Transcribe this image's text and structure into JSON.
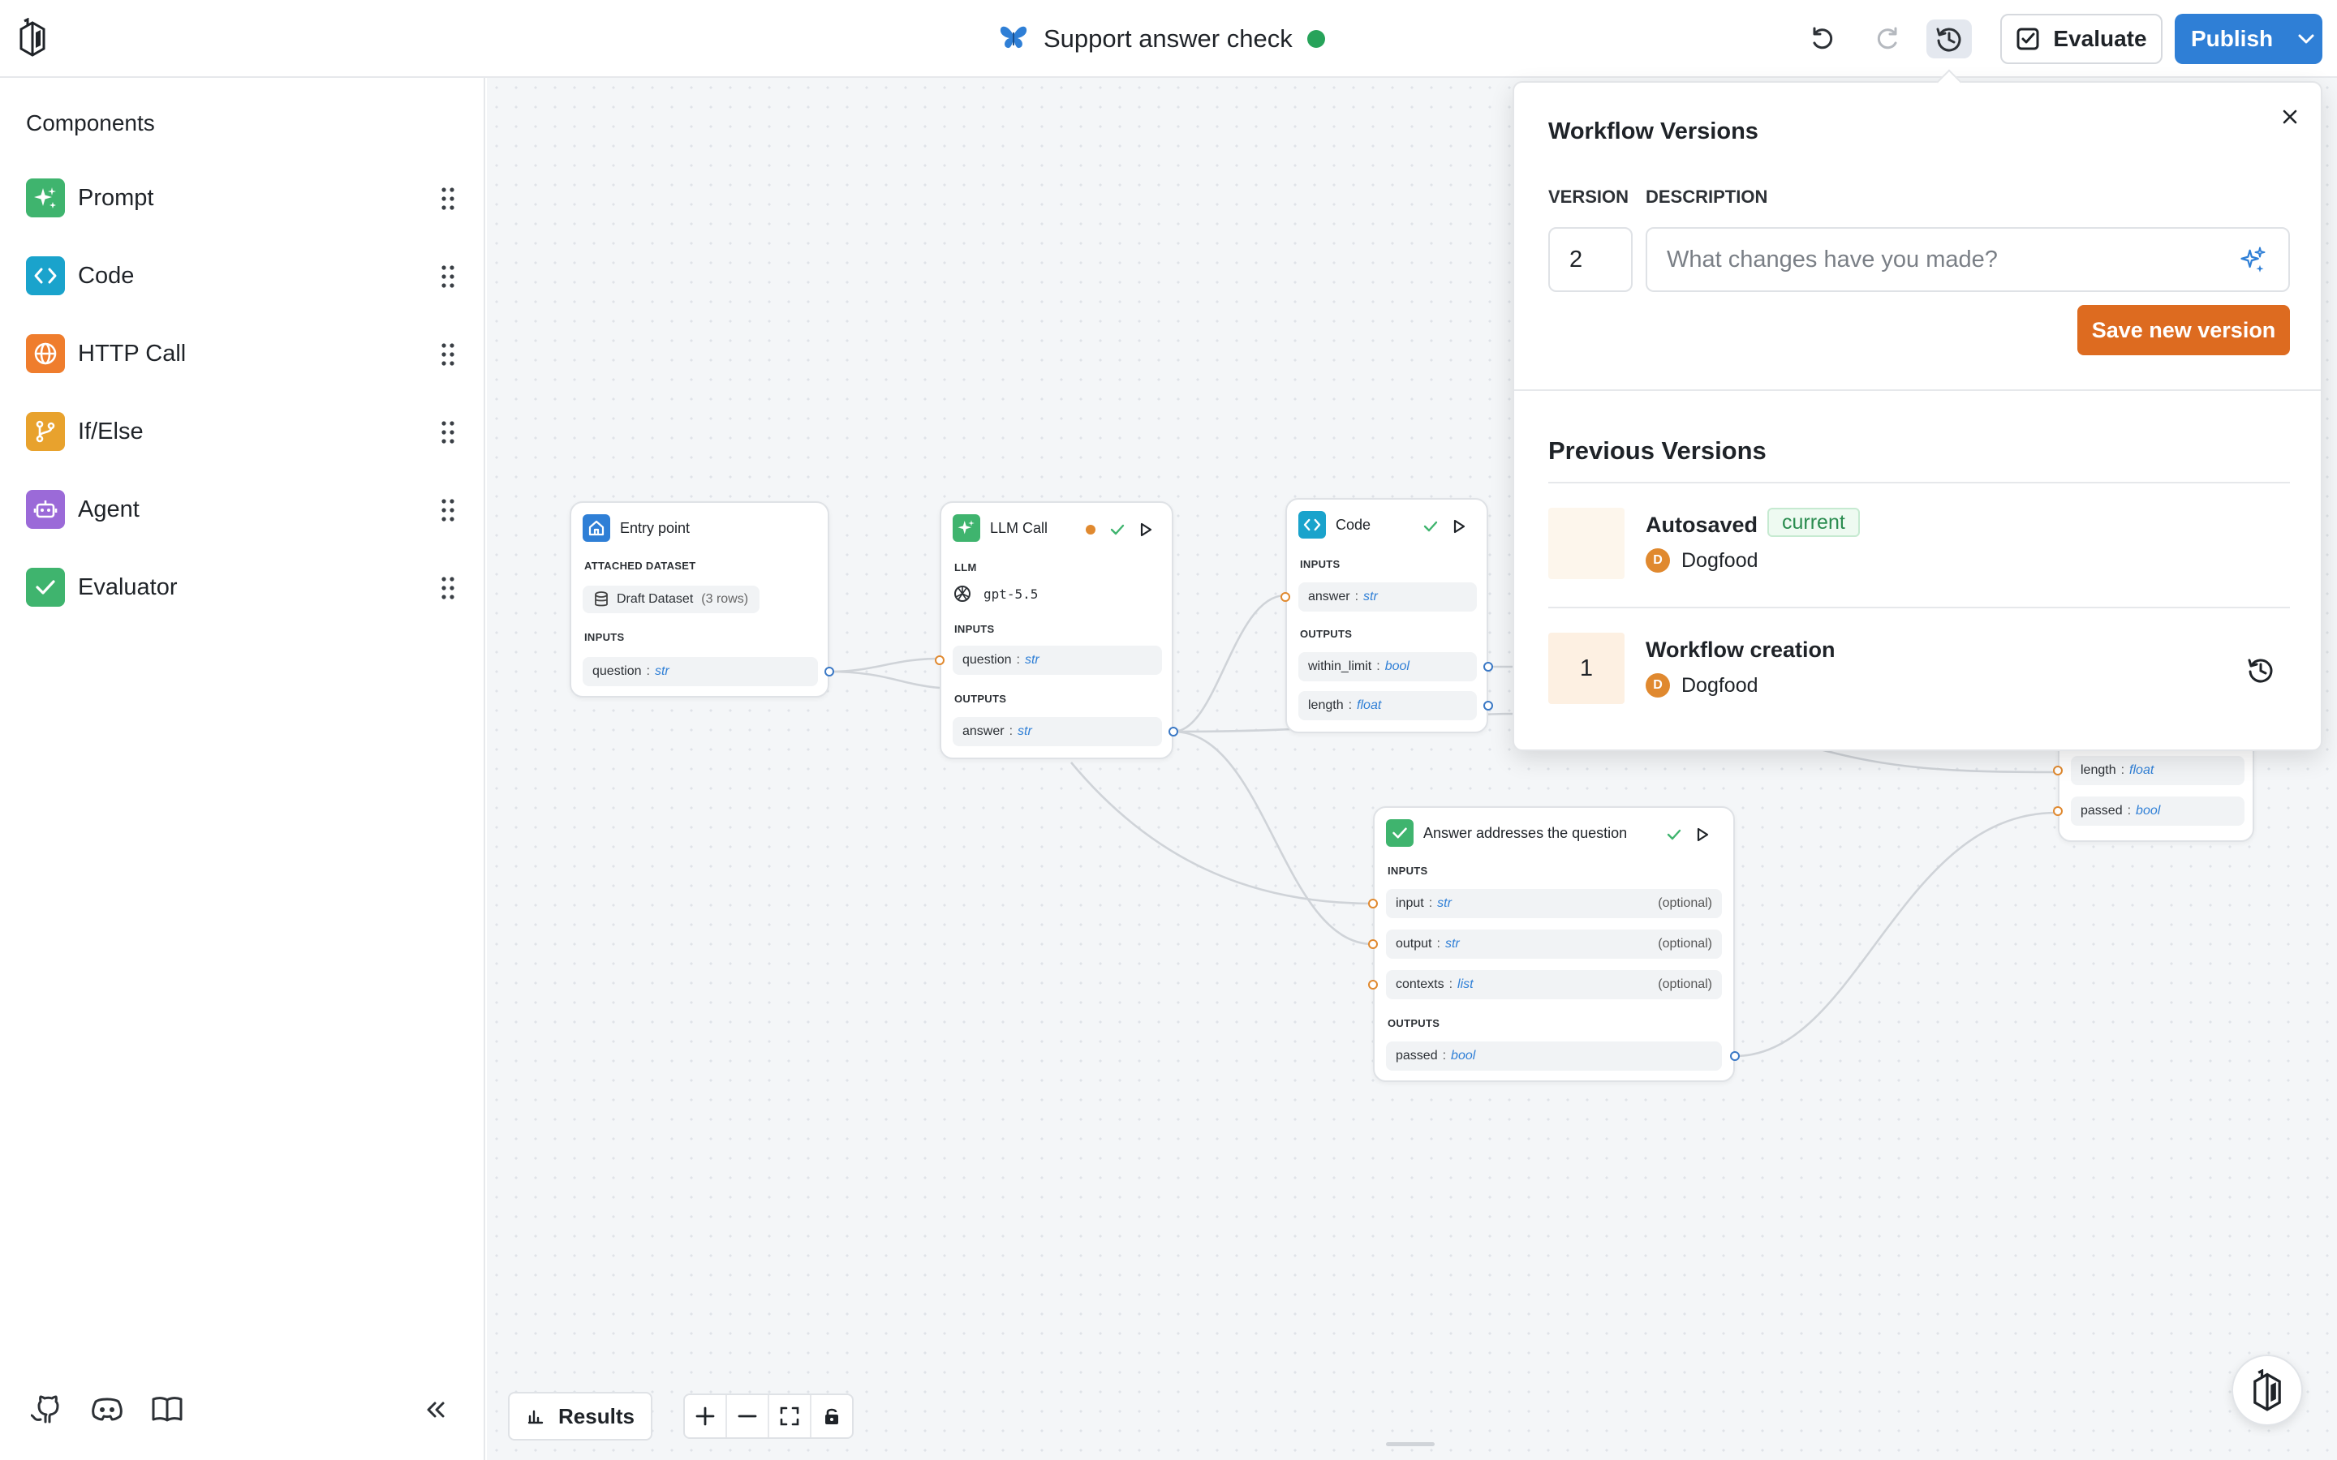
{
  "header": {
    "workflow_name": "Support answer check",
    "evaluate_label": "Evaluate",
    "publish_label": "Publish"
  },
  "sidebar": {
    "title": "Components",
    "items": [
      {
        "label": "Prompt",
        "icon": "sparkle-icon",
        "color": "#3fb46e"
      },
      {
        "label": "Code",
        "icon": "code-icon",
        "color": "#1aa3cc"
      },
      {
        "label": "HTTP Call",
        "icon": "globe-icon",
        "color": "#ef7d2d"
      },
      {
        "label": "If/Else",
        "icon": "branch-icon",
        "color": "#e8a22d"
      },
      {
        "label": "Agent",
        "icon": "robot-icon",
        "color": "#9b6ad8"
      },
      {
        "label": "Evaluator",
        "icon": "check-icon",
        "color": "#3fb46e"
      }
    ]
  },
  "nodes": {
    "entry": {
      "title": "Entry point",
      "dataset_section": "ATTACHED DATASET",
      "dataset_name": "Draft Dataset",
      "dataset_rows": "(3 rows)",
      "inputs_section": "INPUTS",
      "input_name": "question",
      "input_type": "str"
    },
    "llm": {
      "title": "LLM Call",
      "llm_section": "LLM",
      "model": "gpt-5.5",
      "inputs_section": "INPUTS",
      "input_name": "question",
      "input_type": "str",
      "outputs_section": "OUTPUTS",
      "output_name": "answer",
      "output_type": "str"
    },
    "code": {
      "title": "Code",
      "inputs_section": "INPUTS",
      "input_name": "answer",
      "input_type": "str",
      "outputs_section": "OUTPUTS",
      "output1_name": "within_limit",
      "output1_type": "bool",
      "output2_name": "length",
      "output2_type": "float"
    },
    "evaluator": {
      "title": "Answer addresses the question",
      "inputs_section": "INPUTS",
      "in1_name": "input",
      "in1_type": "str",
      "in2_name": "output",
      "in2_type": "str",
      "in3_name": "contexts",
      "in3_type": "list",
      "optional": "(optional)",
      "outputs_section": "OUTPUTS",
      "out_name": "passed",
      "out_type": "bool"
    },
    "end": {
      "f1_name": "length",
      "f1_type": "float",
      "f2_name": "passed",
      "f2_type": "bool"
    }
  },
  "bottom": {
    "results_label": "Results"
  },
  "versions": {
    "title": "Workflow Versions",
    "version_label": "VERSION",
    "description_label": "DESCRIPTION",
    "version_value": "2",
    "description_placeholder": "What changes have you made?",
    "save_label": "Save new version",
    "previous_title": "Previous Versions",
    "rows": [
      {
        "badge": "",
        "name": "Autosaved",
        "tag": "current",
        "author_initial": "D",
        "author": "Dogfood"
      },
      {
        "badge": "1",
        "name": "Workflow creation",
        "tag": "",
        "author_initial": "D",
        "author": "Dogfood"
      }
    ]
  }
}
